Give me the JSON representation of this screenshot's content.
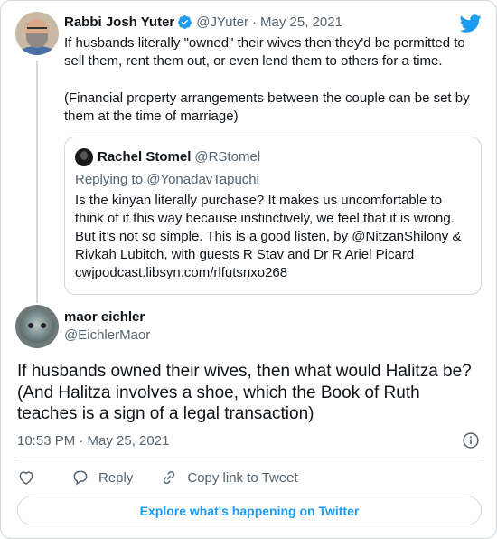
{
  "parent_tweet": {
    "display_name": "Rabbi Josh Yuter",
    "handle": "@JYuter",
    "separator": "·",
    "date": "May 25, 2021",
    "text_p1": "If husbands literally \"owned\" their wives then they'd be permitted to sell them, rent them out, or even lend them to others for a time.",
    "text_p2": "(Financial property arrangements between the couple can be set by them at the time of marriage)",
    "quoted": {
      "display_name": "Rachel Stomel",
      "handle": "@RStomel",
      "replying_prefix": "Replying to",
      "replying_to": "@YonadavTapuchi",
      "text": "Is the kinyan literally purchase? It makes us uncomfortable to think of it this way because instinctively, we feel that it is wrong. But it’s not so simple. This is a good listen, by @NitzanShilony & Rivkah Lubitch, with guests R Stav and Dr R Ariel Picard cwjpodcast.libsyn.com/rlfutsnxo268"
    }
  },
  "main_tweet": {
    "display_name": "maor eichler",
    "handle": "@EichlerMaor",
    "text": "If husbands owned their wives, then what would Halitza be? (And Halitza involves a shoe, which the Book of Ruth teaches is a sign of a legal transaction)",
    "timestamp": "10:53 PM · May 25, 2021"
  },
  "actions": {
    "reply_label": "Reply",
    "copy_link_label": "Copy link to Tweet"
  },
  "explore_label": "Explore what's happening on Twitter",
  "colors": {
    "accent": "#1d9bf0",
    "secondary_text": "#536471",
    "primary_text": "#0f1419",
    "border": "#cfd9de"
  },
  "icons": [
    "verified-badge-icon",
    "twitter-bird-icon",
    "info-icon",
    "heart-icon",
    "reply-icon",
    "copy-link-icon"
  ]
}
